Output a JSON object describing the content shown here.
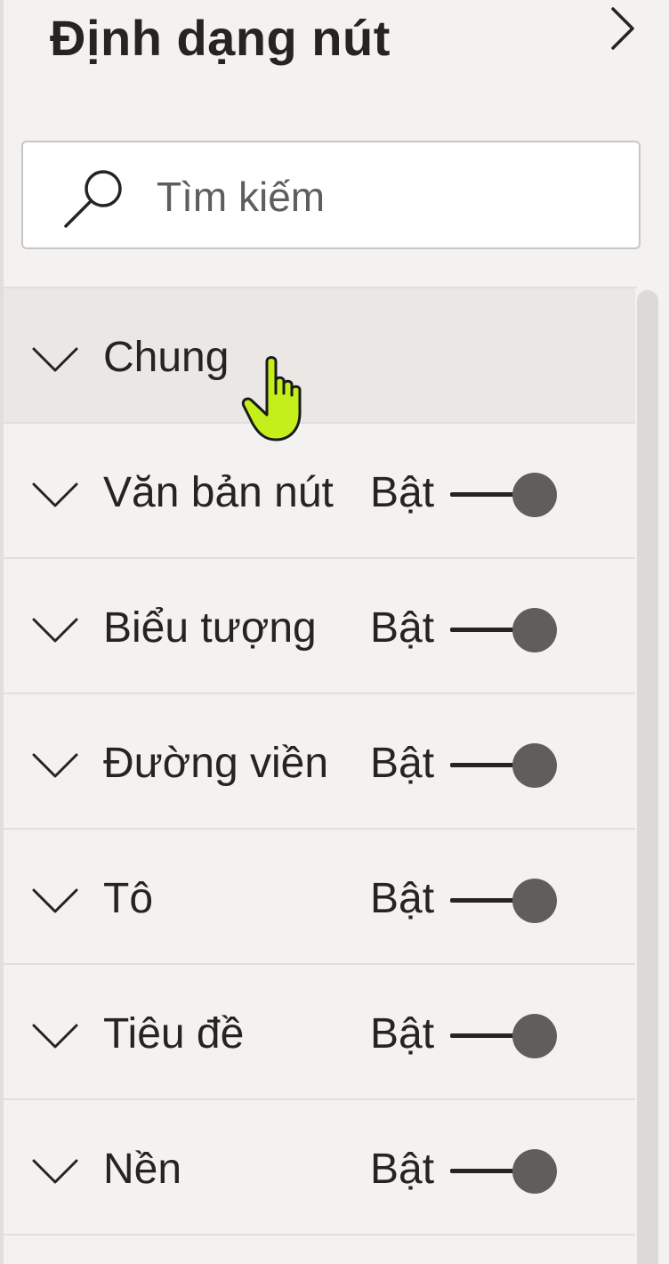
{
  "header": {
    "title": "Định dạng nút",
    "collapse_icon": "chevron-right-icon"
  },
  "search": {
    "placeholder": "Tìm kiếm",
    "value": "",
    "icon": "search-icon"
  },
  "sections": [
    {
      "label": "Chung",
      "has_toggle": false
    },
    {
      "label": "Văn bản nút",
      "has_toggle": true,
      "toggle_text": "Bật",
      "on": true
    },
    {
      "label": "Biểu tượng",
      "has_toggle": true,
      "toggle_text": "Bật",
      "on": true
    },
    {
      "label": "Đường viền",
      "has_toggle": true,
      "toggle_text": "Bật",
      "on": true
    },
    {
      "label": "Tô",
      "has_toggle": true,
      "toggle_text": "Bật",
      "on": true
    },
    {
      "label": "Tiêu đề",
      "has_toggle": true,
      "toggle_text": "Bật",
      "on": true
    },
    {
      "label": "Nền",
      "has_toggle": true,
      "toggle_text": "Bật",
      "on": true
    }
  ],
  "colors": {
    "panel_bg": "#f3f2f1",
    "hover_bg": "#eae7e4",
    "text": "#252423",
    "knob": "#605e5c",
    "cursor": "#c4ef1a"
  },
  "cursor_icon": "hand-pointer-icon"
}
